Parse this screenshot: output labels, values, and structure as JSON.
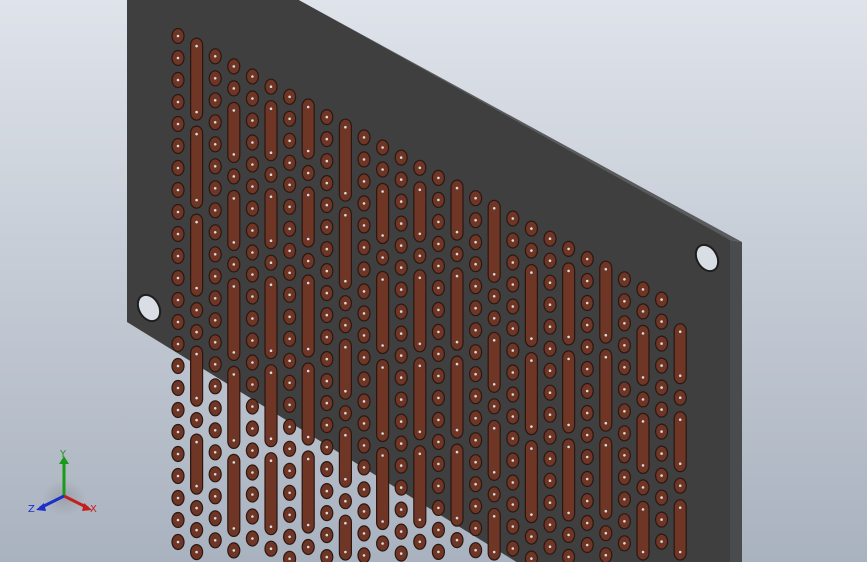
{
  "viewport": {
    "background_top": "#dfe3ea",
    "background_bottom": "#a9b2bf"
  },
  "part": {
    "plate_face_color": "#3f3f40",
    "plate_edge_color": "#5a5b5d",
    "pad_color": "#6f3525",
    "pad_edge_color": "#2a1712",
    "hole_color": "#d9dde4",
    "hole_edge_color": "#1e1e1f"
  },
  "triad": {
    "labels": {
      "x": "X",
      "y": "Y",
      "z": "Z"
    },
    "colors": {
      "x": "#c41f1f",
      "y": "#1a9a1a",
      "z": "#1c2fc9"
    }
  }
}
